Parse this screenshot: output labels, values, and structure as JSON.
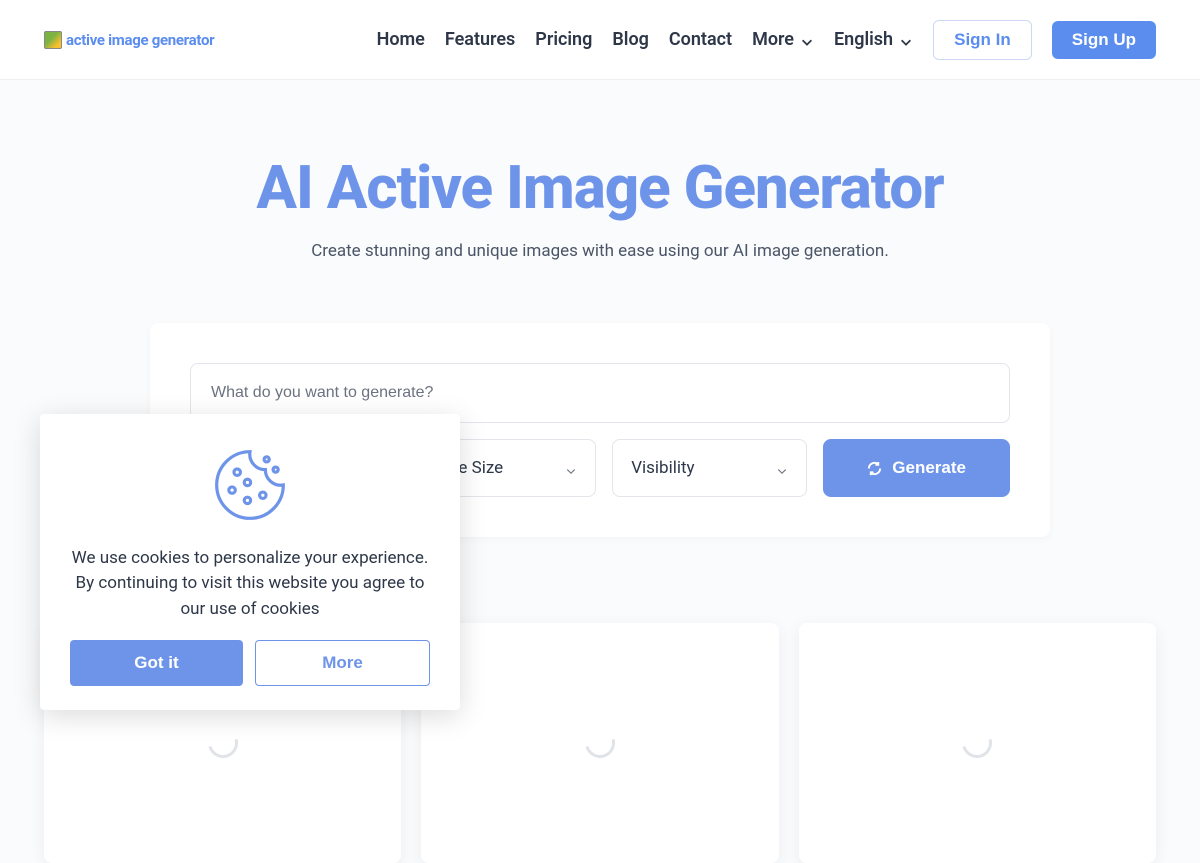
{
  "header": {
    "logo_text": "active image generator",
    "nav": {
      "home": "Home",
      "features": "Features",
      "pricing": "Pricing",
      "blog": "Blog",
      "contact": "Contact",
      "more": "More",
      "language": "English"
    },
    "signin": "Sign In",
    "signup": "Sign Up"
  },
  "hero": {
    "title": "AI Active Image Generator",
    "subtitle": "Create stunning and unique images with ease using our AI image generation."
  },
  "form": {
    "prompt_placeholder": "What do you want to generate?",
    "image_size_label": "Image Size",
    "visibility_label": "Visibility",
    "generate_label": "Generate"
  },
  "cookie": {
    "text": "We use cookies to personalize your experience. By continuing to visit this website you agree to our use of cookies",
    "got_it": "Got it",
    "more": "More"
  }
}
